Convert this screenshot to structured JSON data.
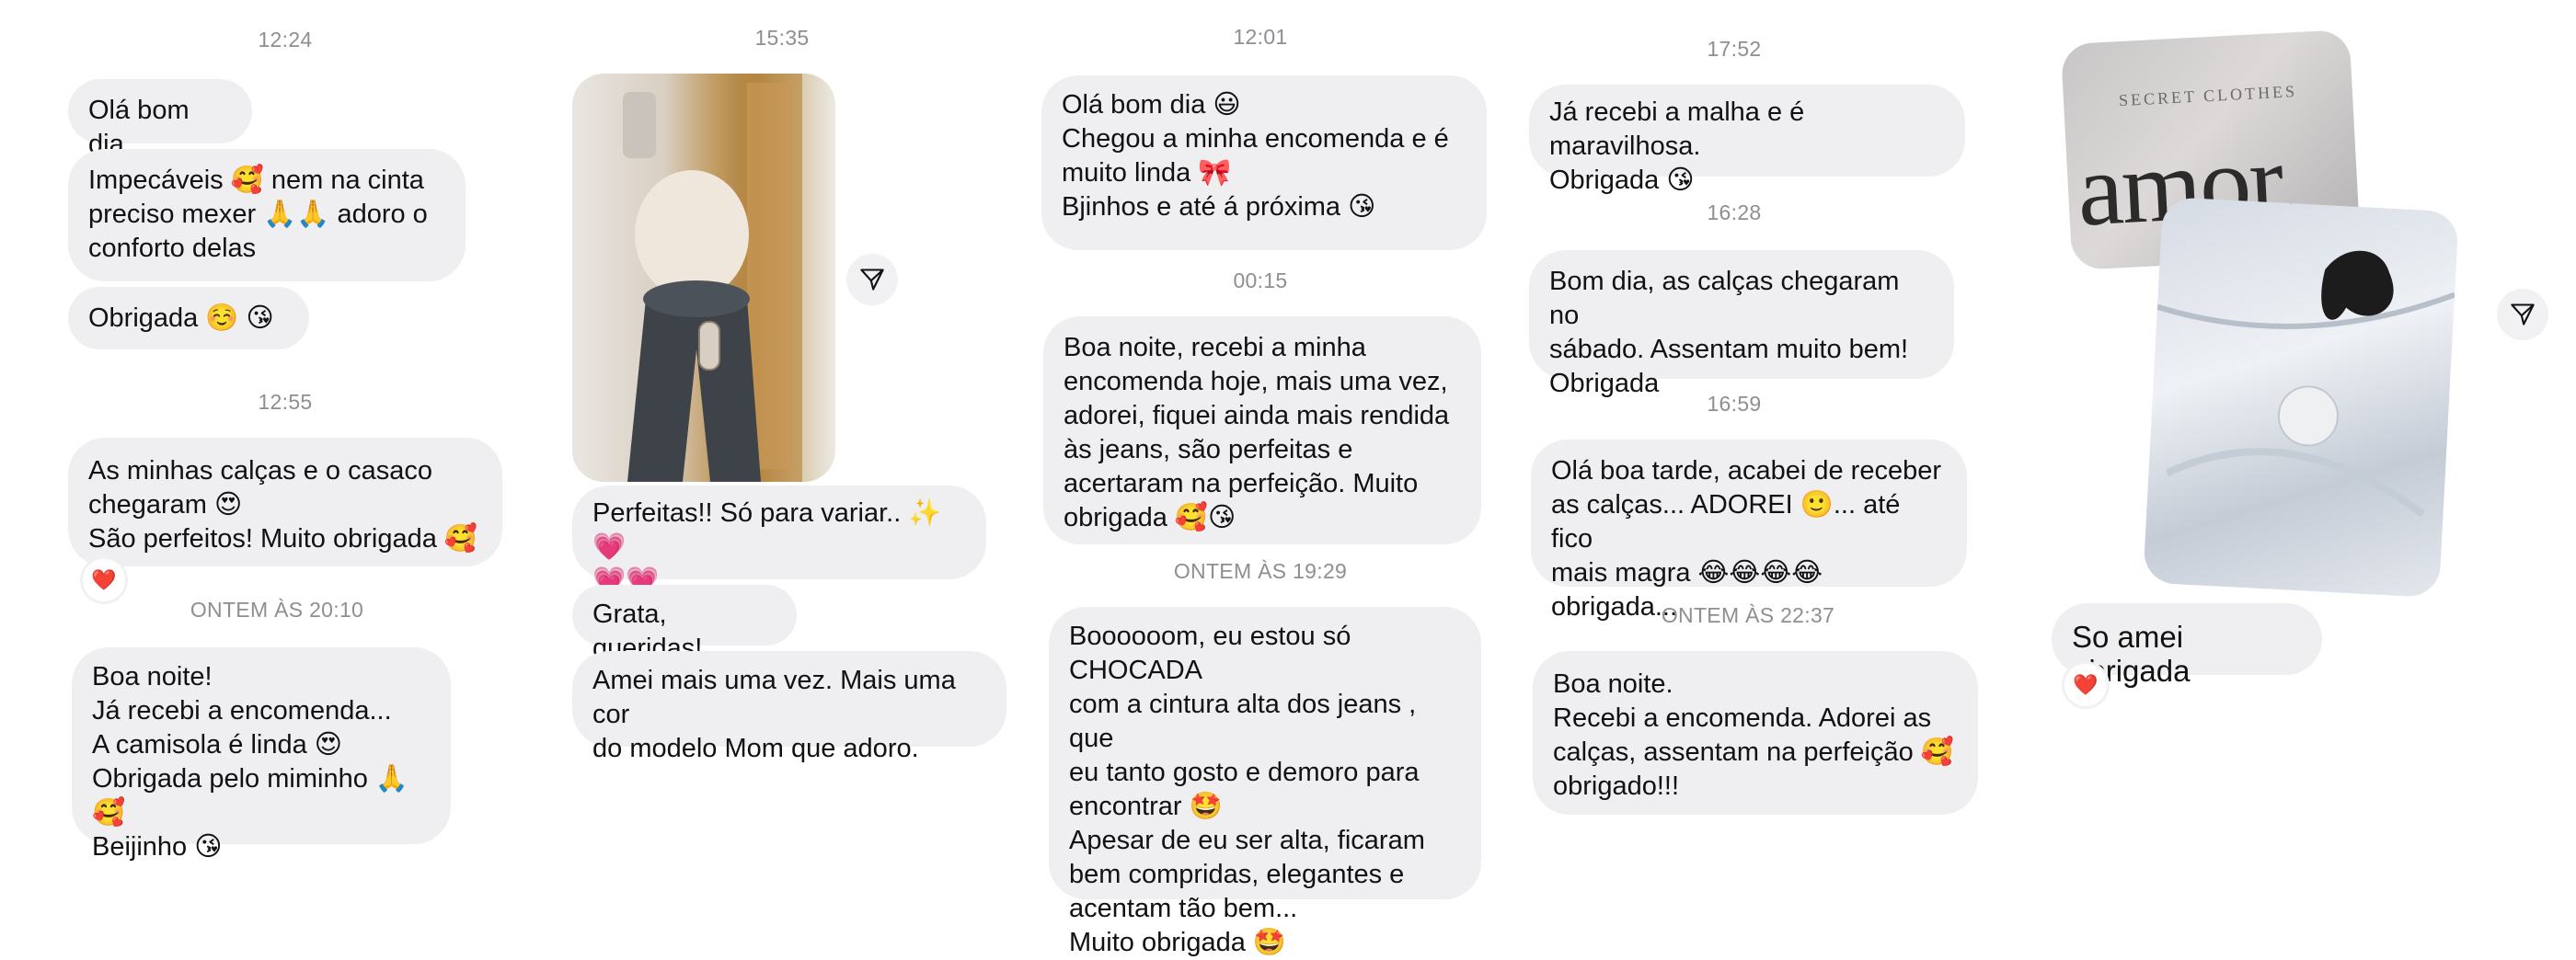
{
  "col1": {
    "ts1": "12:24",
    "msg1": "Olá bom dia",
    "msg2": "Impecáveis 🥰 nem na cinta\npreciso mexer 🙏🙏 adoro o\nconforto delas",
    "msg3": "Obrigada ☺️ 😘",
    "ts2": "12:55",
    "msg4": "As minhas calças e o casaco\nchegaram 😍\nSão perfeitos! Muito obrigada 🥰",
    "reaction": "❤️",
    "ts3": "ONTEM ÀS 20:10",
    "msg5": "Boa noite!\nJá recebi a encomenda...\nA camisola é linda 😍\nObrigada pelo miminho 🙏🥰\nBeijinho 😘"
  },
  "col2": {
    "ts1": "15:35",
    "msg1": "Perfeitas!! Só para variar.. ✨ 💗\n💗💗",
    "msg2": "Grata, queridas!",
    "msg3": "Amei mais uma vez. Mais uma cor\ndo modelo Mom que adoro."
  },
  "col3": {
    "ts1": "12:01",
    "msg1": "Olá bom dia 😃\nChegou a minha encomenda  e é\nmuito linda 🎀\nBjinhos e até á próxima 😘",
    "ts2": "00:15",
    "msg2": "Boa noite, recebi a minha\nencomenda hoje, mais uma vez,\nadorei,  fiquei ainda mais rendida\nàs jeans,  são perfeitas e\nacertaram na perfeição.  Muito\nobrigada 🥰😘",
    "ts3": "ONTEM ÀS 19:29",
    "msg3": "Boooooom, eu estou só CHOCADA\ncom a cintura alta dos jeans , que\neu tanto gosto e demoro para\nencontrar 🤩\nApesar de eu ser alta, ficaram\nbem compridas, elegantes e\nacentam tão bem...\nMuito obrigada 🤩"
  },
  "col4": {
    "ts1": "17:52",
    "msg1": "Já recebi a malha e é maravilhosa.\nObrigada 😘",
    "ts2": "16:28",
    "msg2": "Bom dia, as calças chegaram no\nsábado. Assentam muito bem!\nObrigada",
    "ts3": "16:59",
    "msg3": "Olá boa tarde, acabei de receber\nas calças... ADOREI 🙂... até fico\nmais magra 😂😂😂😂\nobrigada...",
    "ts4": "ONTEM ÀS 22:37",
    "msg4": "Boa noite.\nRecebi a encomenda. Adorei as\ncalças, assentam na perfeição 🥰\nobrigado!!!"
  },
  "col5": {
    "box_text": "amor.",
    "box_small": "SECRET CLOTHES",
    "msg1": "So amei obrigada",
    "reaction": "❤️"
  },
  "icons": {
    "share": "send-icon",
    "heart": "heart-icon"
  }
}
